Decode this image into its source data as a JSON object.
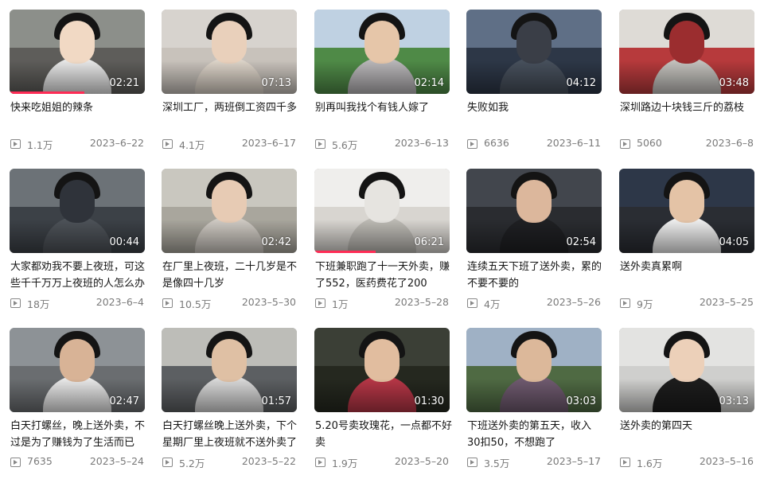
{
  "accent_color": "#fe2c55",
  "videos": [
    {
      "title": "快来吃姐姐的辣条",
      "duration": "02:21",
      "views": "1.1万",
      "date": "2023–6–22",
      "watched": 0.55,
      "palette": [
        "#8c8f8a",
        "#5e5d5a",
        "#f1d9c4",
        "#e7e7e7"
      ]
    },
    {
      "title": "深圳工厂，两班倒工资四千多",
      "duration": "07:13",
      "views": "4.1万",
      "date": "2023–6–17",
      "watched": 0,
      "palette": [
        "#d7d3ce",
        "#c8c2bb",
        "#e9d0bb",
        "#dcd3c8"
      ]
    },
    {
      "title": "别再叫我找个有钱人嫁了",
      "duration": "02:14",
      "views": "5.6万",
      "date": "2023–6–13",
      "watched": 0,
      "palette": [
        "#bfd1e2",
        "#4f8a47",
        "#e6c6a9",
        "#b8b6b9"
      ]
    },
    {
      "title": "失败如我",
      "duration": "04:12",
      "views": "6636",
      "date": "2023–6–11",
      "watched": 0,
      "palette": [
        "#5f6f86",
        "#2d3747",
        "#3a3e47",
        "#47505c"
      ]
    },
    {
      "title": "深圳路边十块钱三斤的荔枝",
      "duration": "03:48",
      "views": "5060",
      "date": "2023–6–8",
      "watched": 0,
      "palette": [
        "#dedbd6",
        "#b73a3c",
        "#9b2d2f",
        "#c4c2be"
      ]
    },
    {
      "title": "大家都劝我不要上夜班，可这些千千万万上夜班的人怎么办",
      "duration": "00:44",
      "views": "18万",
      "date": "2023–6–4",
      "watched": 0,
      "palette": [
        "#6c7277",
        "#3c4147",
        "#2f333a",
        "#4d5258"
      ]
    },
    {
      "title": "在厂里上夜班，二十几岁是不是像四十几岁",
      "duration": "02:42",
      "views": "10.5万",
      "date": "2023–5–30",
      "watched": 0,
      "palette": [
        "#c9c7bf",
        "#a9a69d",
        "#e7cbb4",
        "#cfcac3"
      ]
    },
    {
      "title": "下班兼职跑了十一天外卖，赚了552，医药费花了200",
      "duration": "06:21",
      "views": "1万",
      "date": "2023–5–28",
      "watched": 0.45,
      "palette": [
        "#efeeec",
        "#d8d5d0",
        "#e6e4e0",
        "#bdbab5"
      ]
    },
    {
      "title": "连续五天下班了送外卖，累的不要不要的",
      "duration": "02:54",
      "views": "4万",
      "date": "2023–5–26",
      "watched": 0,
      "palette": [
        "#42464d",
        "#2a2c30",
        "#dcb79c",
        "#1f2023"
      ]
    },
    {
      "title": "送外卖真累啊",
      "duration": "04:05",
      "views": "9万",
      "date": "2023–5–25",
      "watched": 0,
      "palette": [
        "#2d3748",
        "#2a2d33",
        "#e4c3a6",
        "#efefef"
      ]
    },
    {
      "title": "白天打螺丝，晚上送外卖，不过是为了赚钱为了生活而已",
      "duration": "02:47",
      "views": "7635",
      "date": "2023–5–24",
      "watched": 0,
      "palette": [
        "#8d9296",
        "#6a6d70",
        "#d8b396",
        "#e8e8e8"
      ]
    },
    {
      "title": "白天打螺丝晚上送外卖，下个星期厂里上夜班就不送外卖了",
      "duration": "01:57",
      "views": "5.2万",
      "date": "2023–5–22",
      "watched": 0,
      "palette": [
        "#bdbdb8",
        "#5c5f62",
        "#dfc0a4",
        "#d9d9d9"
      ]
    },
    {
      "title": "5.20号卖玫瑰花，一点都不好卖",
      "duration": "01:30",
      "views": "1.9万",
      "date": "2023–5–20",
      "watched": 0,
      "palette": [
        "#3b3f36",
        "#25281f",
        "#e1bd9f",
        "#b63646"
      ]
    },
    {
      "title": "下班送外卖的第五天，收入30扣50，不想跑了",
      "duration": "03:03",
      "views": "3.5万",
      "date": "2023–5–17",
      "watched": 0,
      "palette": [
        "#9fb1c5",
        "#4f6a43",
        "#dcb89a",
        "#6f5a6f"
      ]
    },
    {
      "title": "送外卖的第四天",
      "duration": "03:13",
      "views": "1.6万",
      "date": "2023–5–16",
      "watched": 0,
      "palette": [
        "#e3e3e1",
        "#cfcfcd",
        "#ecd0b9",
        "#1d1d1d"
      ]
    }
  ]
}
